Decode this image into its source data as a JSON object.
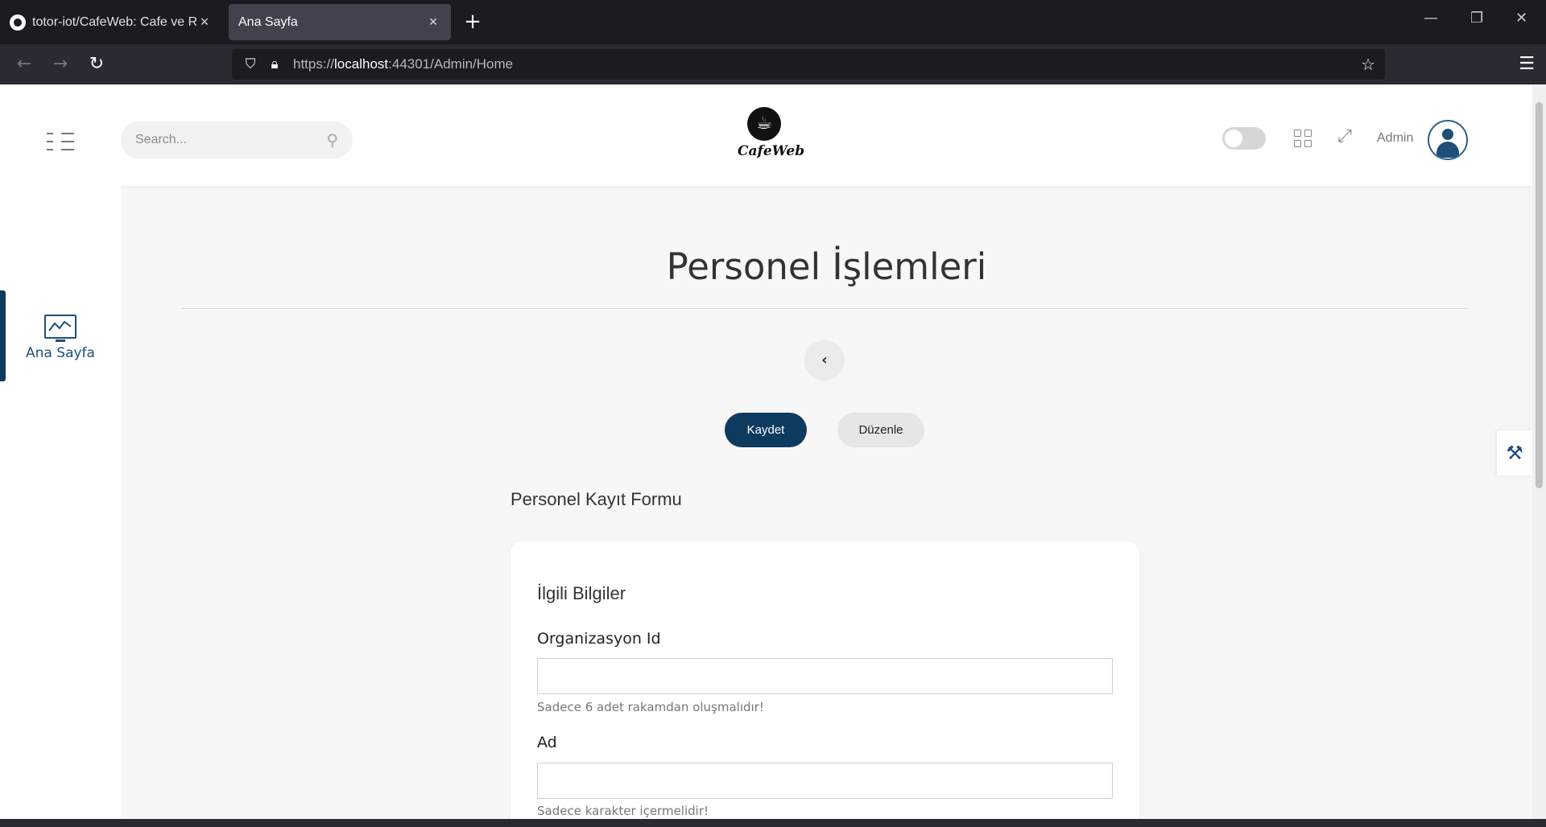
{
  "browser": {
    "tabs": [
      {
        "title": "totor-iot/CafeWeb: Cafe ve Resta",
        "active": false
      },
      {
        "title": "Ana Sayfa",
        "active": true
      }
    ],
    "url_prefix": "https://",
    "url_host": "localhost",
    "url_rest": ":44301/Admin/Home"
  },
  "header": {
    "search_placeholder": "Search...",
    "logo_text": "CafeWeb",
    "admin_label": "Admin"
  },
  "sidebar": {
    "items": [
      {
        "label": "Ana Sayfa",
        "icon": "monitor-chart-icon"
      }
    ]
  },
  "main": {
    "title": "Personel İşlemleri",
    "back_label": "‹",
    "save_label": "Kaydet",
    "edit_label": "Düzenle",
    "form_heading": "Personel Kayıt Formu",
    "card_title": "İlgili Bilgiler",
    "fields": [
      {
        "label": "Organizasyon Id",
        "value": "",
        "hint": "Sadece 6 adet rakamdan oluşmalıdır!"
      },
      {
        "label": "Ad",
        "value": "",
        "hint": "Sadece karakter içermelidir!"
      }
    ]
  },
  "colors": {
    "primary": "#0d3a5f",
    "accent": "#1f4e79"
  }
}
